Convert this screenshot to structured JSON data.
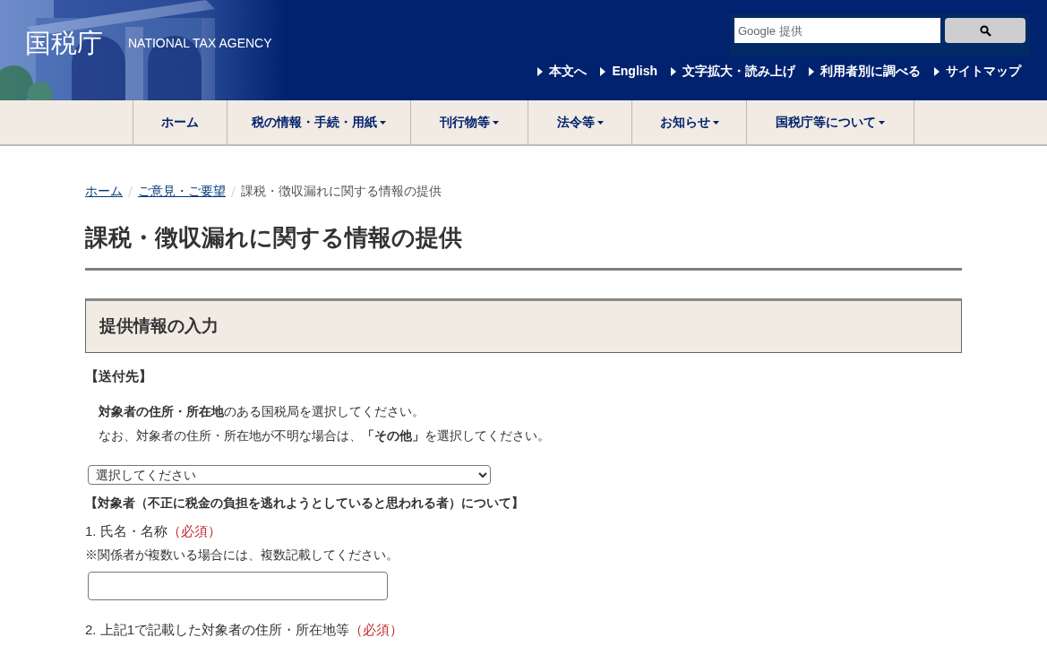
{
  "header": {
    "logo": "国税庁",
    "subtitle": "NATIONAL TAX AGENCY",
    "search": {
      "placeholder": "Google 提供"
    },
    "utility_links": [
      "本文へ",
      "English",
      "文字拡大・読み上げ",
      "利用者別に調べる",
      "サイトマップ"
    ]
  },
  "nav": [
    {
      "label": "ホーム",
      "dropdown": false
    },
    {
      "label": "税の情報・手続・用紙",
      "dropdown": true
    },
    {
      "label": "刊行物等",
      "dropdown": true
    },
    {
      "label": "法令等",
      "dropdown": true
    },
    {
      "label": "お知らせ",
      "dropdown": true
    },
    {
      "label": "国税庁等について",
      "dropdown": true
    }
  ],
  "breadcrumb": [
    {
      "label": "ホーム",
      "link": true
    },
    {
      "label": "ご意見・ご要望",
      "link": true
    },
    {
      "label": "課税・徴収漏れに関する情報の提供",
      "link": false
    }
  ],
  "page_title": "課税・徴収漏れに関する情報の提供",
  "section_title": "提供情報の入力",
  "form": {
    "destination_heading": "【送付先】",
    "instructions": [
      "**対象者の住所・所在地**のある国税局を選択してください。",
      "なお、対象者の住所・所在地が不明な場合は、**「その他」**を選択してください。"
    ],
    "select": {
      "value": "選択してください"
    },
    "target_heading": "【対象者（不正に税金の負担を逃れようとしていると思われる者）について】",
    "fields": [
      {
        "label": "1. 氏名・名称",
        "required": "（必須）",
        "note": "※関係者が複数いる場合には、複数記載してください。",
        "kind": "text"
      },
      {
        "label": "2. 上記1で記載した対象者の住所・所在地等",
        "required": "（必須）",
        "kind": "heading"
      }
    ]
  }
}
